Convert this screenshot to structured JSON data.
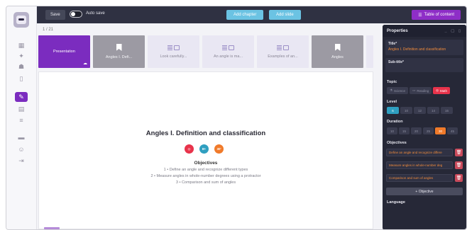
{
  "toolbar": {
    "save_label": "Save",
    "autosave_label": "Auto save",
    "add_chapter_label": "Add chapter",
    "add_slide_label": "Add slide",
    "toc_label": "Table of content"
  },
  "slide_counter": "1 / 21",
  "slides": [
    {
      "label": "Presentation",
      "style": "active"
    },
    {
      "label": "Angles I. Defi...",
      "style": "gray"
    },
    {
      "label": "Look carefully...",
      "style": "light"
    },
    {
      "label": "An angle is ma...",
      "style": "light"
    },
    {
      "label": "Examples of an...",
      "style": "light"
    },
    {
      "label": "Angles",
      "style": "gray"
    }
  ],
  "slide": {
    "title": "Angles I. Definition and classification",
    "badges": [
      "",
      "8+",
      "30'"
    ],
    "objectives_heading": "Objectives",
    "objectives": [
      "1 • Define an angle and recognize different types",
      "2 • Measure angles in whole-number degrees using a protractor",
      "3 • Comparison and sum of angles"
    ]
  },
  "panel": {
    "title": "Properties",
    "title_field_label": "Title*",
    "title_field_value": "Angles I. Definition and classification",
    "subtitle_label": "Sub-title*",
    "topic_label": "Topic",
    "topics": [
      "Science",
      "Reading",
      "Math"
    ],
    "level_label": "Level",
    "levels": [
      "6",
      "10",
      "12",
      "14",
      "16"
    ],
    "duration_label": "Duration",
    "durations": [
      "10",
      "15",
      "20",
      "25",
      "30",
      "45"
    ],
    "objectives_label": "Objectives",
    "objective_items": [
      "Define an angle and recognize differe",
      "Measure angles in whole-number deg",
      "Comparison and sum of angles"
    ],
    "add_objective_label": "+ Objective",
    "language_label": "Language"
  },
  "colors": {
    "accent_purple": "#7b2cbf",
    "toolbar_bg": "#2f3142",
    "button_blue": "#6bc3e3",
    "panel_bg": "#262837",
    "highlight_orange": "#f07a2a",
    "math_red": "#e8334b",
    "level_blue": "#2f9fc0"
  }
}
